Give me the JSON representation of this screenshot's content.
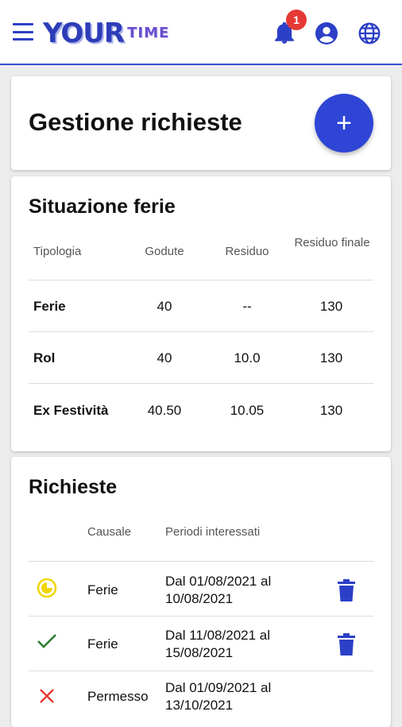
{
  "header": {
    "logo_main": "YOUR",
    "logo_sub": "TIME",
    "notification_count": "1",
    "icons": [
      "menu-icon",
      "bell-icon",
      "account-icon",
      "globe-icon"
    ],
    "accent_color": "#2f45d6"
  },
  "page": {
    "title": "Gestione richieste",
    "add_button_label": "+"
  },
  "ferie": {
    "title": "Situazione ferie",
    "columns": [
      "Tipologia",
      "Godute",
      "Residuo",
      "Residuo finale"
    ],
    "rows": [
      {
        "type": "Ferie",
        "godute": "40",
        "residuo": "--",
        "finale": "130"
      },
      {
        "type": "Rol",
        "godute": "40",
        "residuo": "10.0",
        "finale": "130"
      },
      {
        "type": "Ex Festività",
        "godute": "40.50",
        "residuo": "10.05",
        "finale": "130"
      }
    ]
  },
  "richieste": {
    "title": "Richieste",
    "columns": [
      "Causale",
      "Periodi interessati"
    ],
    "rows": [
      {
        "status": "pending",
        "status_icon": "clock-icon",
        "causale": "Ferie",
        "period_line1": "Dal 01/08/2021 al",
        "period_line2": "10/08/2021",
        "status_color": "#f2d600"
      },
      {
        "status": "approved",
        "status_icon": "check-icon",
        "causale": "Ferie",
        "period_line1": "Dal 11/08/2021 al",
        "period_line2": "15/08/2021",
        "status_color": "#2e7d32"
      },
      {
        "status": "rejected",
        "status_icon": "cross-icon",
        "causale": "Permesso",
        "period_line1": "Dal 01/09/2021 al",
        "period_line2": "13/10/2021",
        "status_color": "#e53935"
      }
    ]
  }
}
